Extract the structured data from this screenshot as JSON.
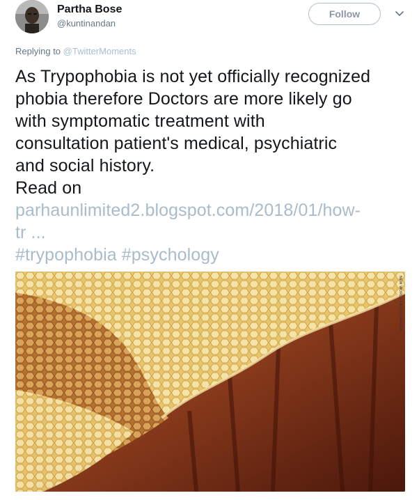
{
  "author": {
    "name": "Partha Bose",
    "handle": "@kuntinandan"
  },
  "follow_label": "Follow",
  "replying": {
    "prefix": "Replying to ",
    "mention": "@TwitterMoments"
  },
  "tweet": {
    "line1": "As Trypophobia is not yet officially recognized",
    "line2": "phobia therefore Doctors  are more likely go",
    "line3": "with symptomatic treatment with",
    "line4": "consultation  patient's medical, psychiatric",
    "line5": "and social history.",
    "line6": "Read on",
    "link_line1": "parhaunlimited2.blogspot.com/2018/01/how-",
    "link_line2": "tr ...",
    "hashtags": "#trypophobia #psychology"
  },
  "media": {
    "alt_icon": "honeycomb-photo",
    "credit": "NEW WORLD ENCYCLOPEDIA"
  },
  "colors": {
    "link": "#a9bccb",
    "follow_border": "#b3c0cb",
    "muted": "#657786"
  }
}
